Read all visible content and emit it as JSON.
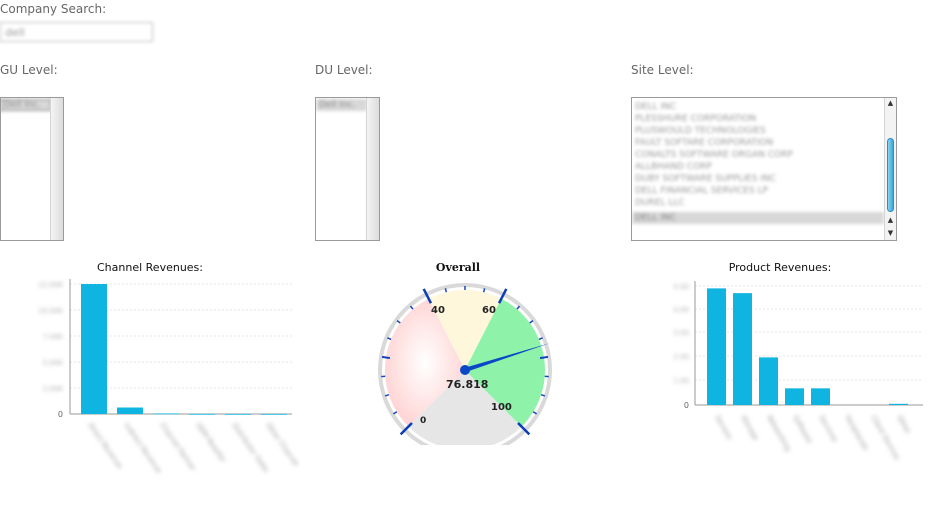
{
  "company_search": {
    "label": "Company Search:",
    "value": "dell"
  },
  "gu_level": {
    "label": "GU Level:",
    "items": [
      "Dell Inc."
    ]
  },
  "du_level": {
    "label": "DU Level:",
    "items": [
      "Dell Inc."
    ]
  },
  "site_level": {
    "label": "Site Level:",
    "items": [
      "DELL INC",
      "PLESSHURE CORPORATION",
      "PLUSWOULD TECHNOLOGIES",
      "FAULT SOFTARE CORPORATION",
      "CONALTS SOFTWARE ORGAN CORP",
      "ALLBHAND CORP",
      "DUBY SOFTWARE SUPPLIES INC",
      "DELL FINANCIAL SERVICES LP",
      "DUREL LLC",
      "DELL INC"
    ]
  },
  "colors": {
    "bar": "#0fb4e0",
    "needle": "#0a48c8",
    "gauge_red": "#ffd6d6",
    "gauge_yellow": "#fff7dc",
    "gauge_green": "#8ef3a8",
    "gauge_gray": "#e6e6e6"
  },
  "channel_chart": {
    "title": "Channel Revenues:",
    "y_ticks": [
      "12.00K",
      "10.00K",
      "7.00K",
      "5.00K",
      "2.00K",
      "0"
    ],
    "categories": [
      "Direct Revenue",
      "Indirect Revenue",
      "Channel Partner",
      "OEM Reseller",
      "Distributor Sales",
      "Other Channel"
    ]
  },
  "gauge": {
    "title": "Overall",
    "value": "76.818",
    "labels": [
      "0",
      "40",
      "60",
      "100"
    ]
  },
  "product_chart": {
    "title": "Product Revenues:",
    "y_ticks": [
      "5.00",
      "4.00",
      "3.00",
      "2.00",
      "1.00",
      "0"
    ],
    "categories": [
      "Servers",
      "Storage",
      "Networking",
      "Software",
      "Services",
      "Peripherals",
      "Client Devices",
      "Other"
    ]
  },
  "chart_data": [
    {
      "type": "bar",
      "title": "Channel Revenues:",
      "categories": [
        "Direct Revenue",
        "Indirect Revenue",
        "Channel Partner",
        "OEM Reseller",
        "Distributor Sales",
        "Other Channel"
      ],
      "values": [
        12000,
        600,
        50,
        10,
        5,
        5
      ],
      "ylim": [
        0,
        12500
      ]
    },
    {
      "type": "bar",
      "title": "Product Revenues:",
      "categories": [
        "Servers",
        "Storage",
        "Networking",
        "Software",
        "Services",
        "Peripherals",
        "Client Devices",
        "Other"
      ],
      "values": [
        4.9,
        4.7,
        2.0,
        0.7,
        0.7,
        0,
        0,
        0.05
      ],
      "ylim": [
        0,
        5.2
      ]
    },
    {
      "type": "gauge",
      "title": "Overall",
      "value": 76.818,
      "range": [
        0,
        100
      ],
      "bands": [
        [
          0,
          40
        ],
        [
          40,
          60
        ],
        [
          60,
          100
        ]
      ]
    }
  ]
}
